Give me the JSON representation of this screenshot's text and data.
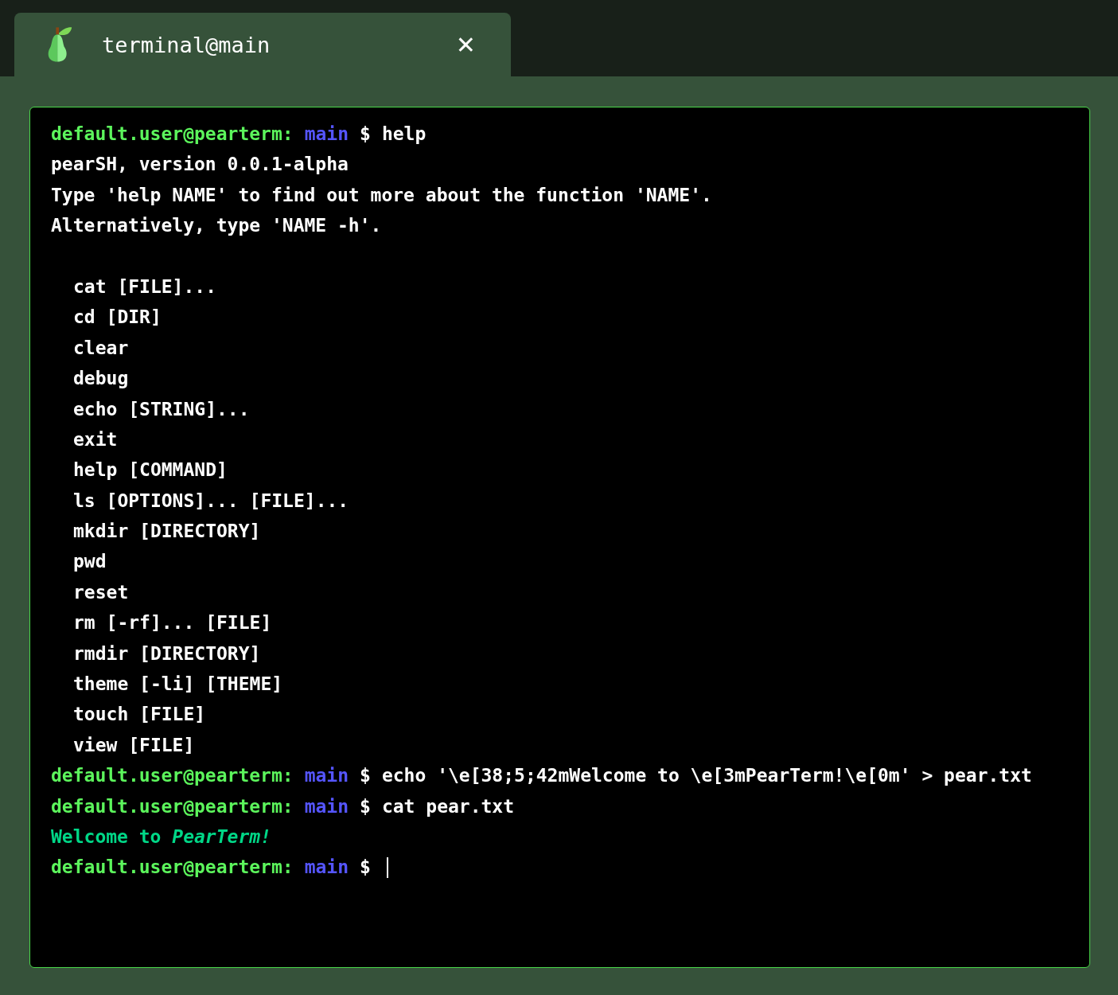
{
  "tabs": [
    {
      "title": "terminal@main",
      "selected": true,
      "close": "✕"
    }
  ],
  "lines": [
    {
      "kind": "prompt",
      "user": "default.user@pearterm:",
      "branch": "main",
      "symbol": "$",
      "command": "help",
      "cursor": false
    },
    {
      "kind": "output",
      "text": "pearSH, version 0.0.1-alpha"
    },
    {
      "kind": "output",
      "text": "Type 'help NAME' to find out more about the function 'NAME'."
    },
    {
      "kind": "output",
      "text": "Alternatively, type 'NAME -h'."
    },
    {
      "kind": "blank"
    },
    {
      "kind": "indented",
      "text": "cat [FILE]..."
    },
    {
      "kind": "indented",
      "text": "cd [DIR]"
    },
    {
      "kind": "indented",
      "text": "clear"
    },
    {
      "kind": "indented",
      "text": "debug"
    },
    {
      "kind": "indented",
      "text": "echo [STRING]..."
    },
    {
      "kind": "indented",
      "text": "exit"
    },
    {
      "kind": "indented",
      "text": "help [COMMAND]"
    },
    {
      "kind": "indented",
      "text": "ls [OPTIONS]... [FILE]..."
    },
    {
      "kind": "indented",
      "text": "mkdir [DIRECTORY]"
    },
    {
      "kind": "indented",
      "text": "pwd"
    },
    {
      "kind": "indented",
      "text": "reset"
    },
    {
      "kind": "indented",
      "text": "rm [-rf]... [FILE]"
    },
    {
      "kind": "indented",
      "text": "rmdir [DIRECTORY]"
    },
    {
      "kind": "indented",
      "text": "theme [-li] [THEME]"
    },
    {
      "kind": "indented",
      "text": "touch [FILE]"
    },
    {
      "kind": "indented",
      "text": "view [FILE]"
    },
    {
      "kind": "prompt",
      "user": "default.user@pearterm:",
      "branch": "main",
      "symbol": "$",
      "command": "echo '\\e[38;5;42mWelcome to \\e[3mPearTerm!\\e[0m' > pear.txt",
      "cursor": false
    },
    {
      "kind": "prompt",
      "user": "default.user@pearterm:",
      "branch": "main",
      "symbol": "$",
      "command": "cat pear.txt",
      "cursor": false
    },
    {
      "kind": "colored",
      "text": "Welcome to *PearTerm!*",
      "color": "#00d787"
    },
    {
      "kind": "prompt",
      "user": "default.user@pearterm:",
      "branch": "main",
      "symbol": "$",
      "cursor": true
    }
  ]
}
